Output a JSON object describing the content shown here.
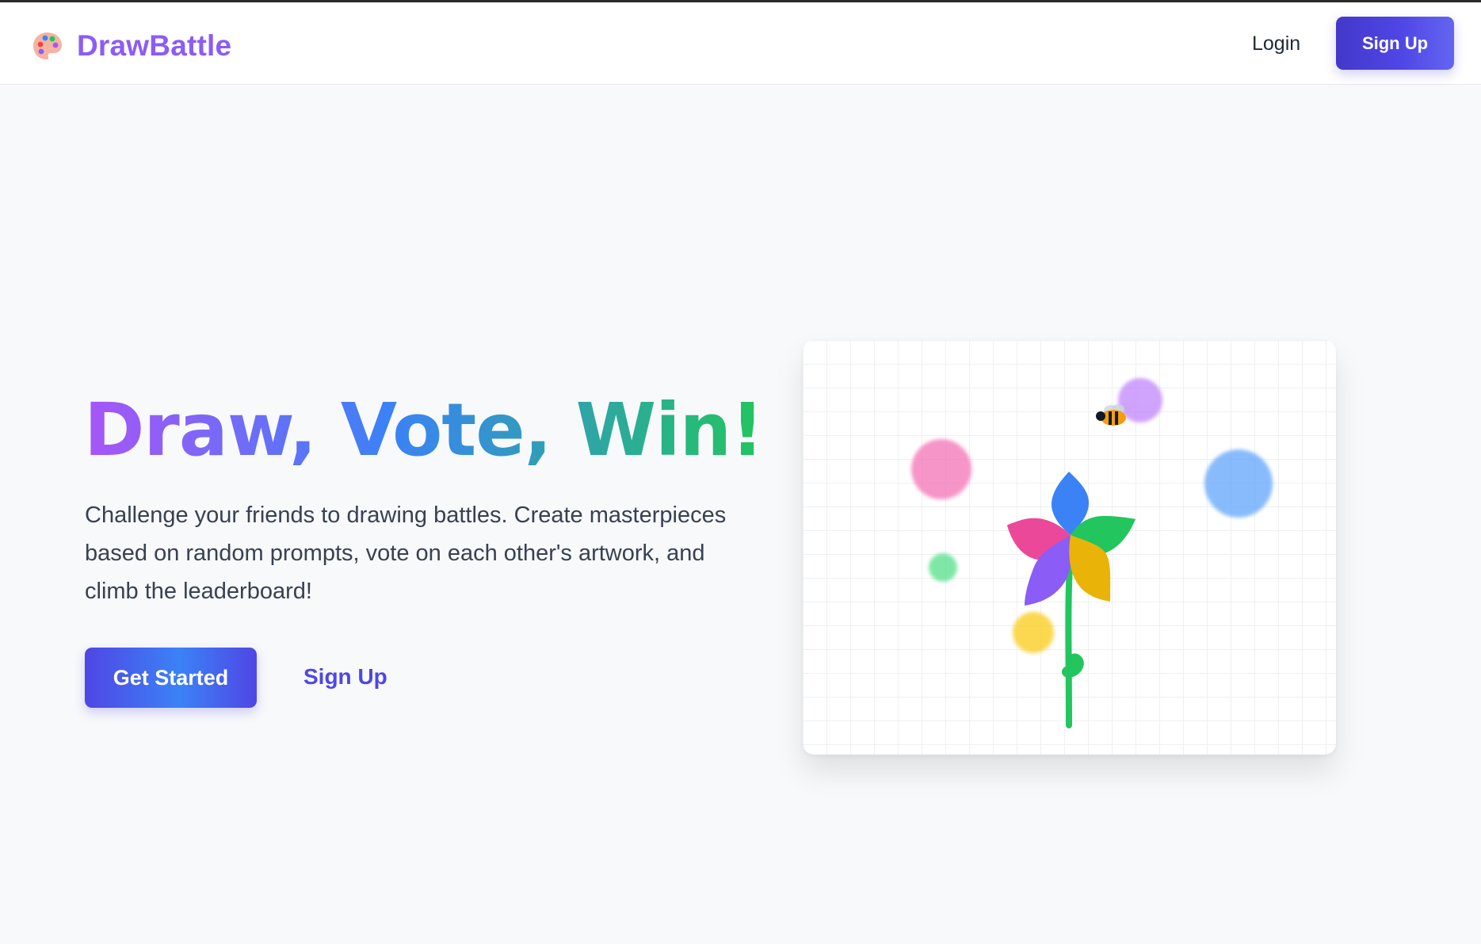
{
  "nav": {
    "brand": "DrawBattle",
    "login": "Login",
    "signup": "Sign Up"
  },
  "hero": {
    "title": "Draw, Vote, Win!",
    "description": "Challenge your friends to drawing battles. Create masterpieces based on random prompts, vote on each other's artwork, and climb the leaderboard!",
    "get_started": "Get Started",
    "signup": "Sign Up"
  },
  "icons": {
    "brand": "palette-icon",
    "illustration": "flower-drawing",
    "bee": "bee-icon"
  },
  "colors": {
    "brand": "#8b5cf6",
    "primary": "#4f46e5",
    "accent_blue": "#3b82f6",
    "gradient_start": "#a855f7",
    "gradient_end": "#22c55e",
    "page_background": "#f8f9fb"
  }
}
